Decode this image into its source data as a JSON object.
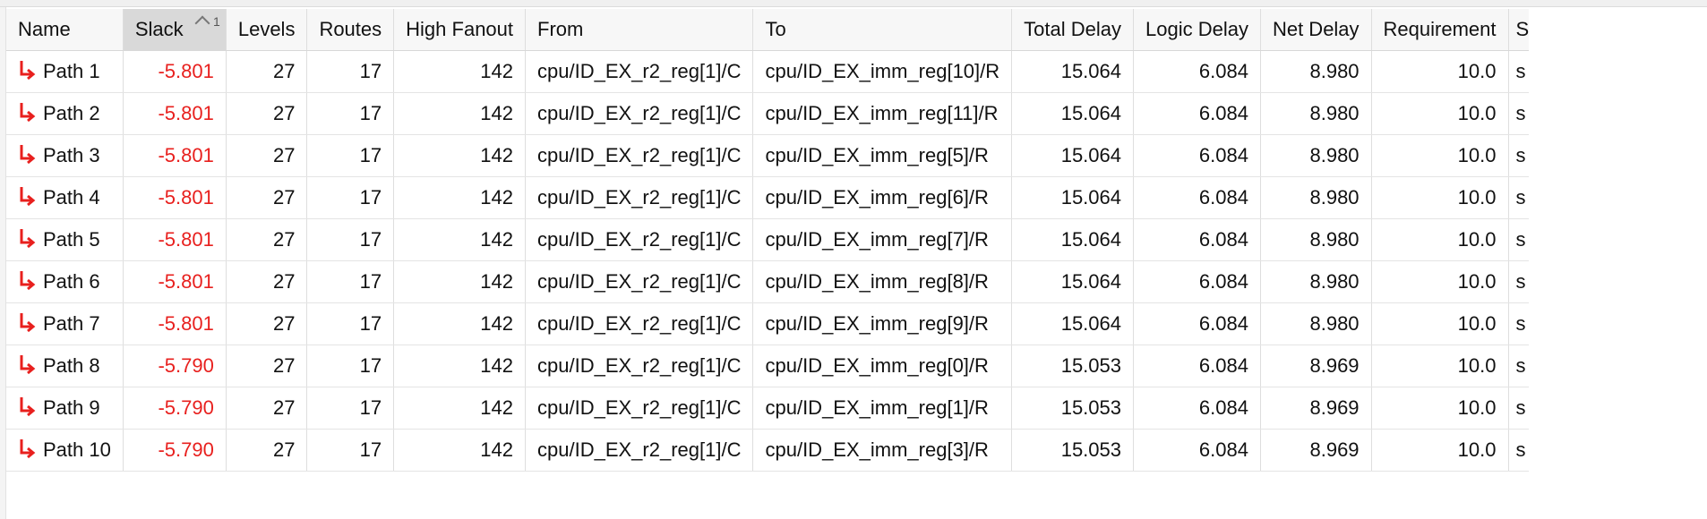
{
  "columns": {
    "name": "Name",
    "slack": "Slack",
    "slack_sort_rank": "1",
    "levels": "Levels",
    "routes": "Routes",
    "high_fanout": "High Fanout",
    "from": "From",
    "to": "To",
    "total_delay": "Total Delay",
    "logic_delay": "Logic Delay",
    "net_delay": "Net Delay",
    "requirement": "Requirement",
    "next_partial": "S"
  },
  "rows": [
    {
      "name": "Path 1",
      "slack": "-5.801",
      "levels": "27",
      "routes": "17",
      "high_fanout": "142",
      "from": "cpu/ID_EX_r2_reg[1]/C",
      "to": "cpu/ID_EX_imm_reg[10]/R",
      "total_delay": "15.064",
      "logic_delay": "6.084",
      "net_delay": "8.980",
      "requirement": "10.0",
      "next_partial": "s"
    },
    {
      "name": "Path 2",
      "slack": "-5.801",
      "levels": "27",
      "routes": "17",
      "high_fanout": "142",
      "from": "cpu/ID_EX_r2_reg[1]/C",
      "to": "cpu/ID_EX_imm_reg[11]/R",
      "total_delay": "15.064",
      "logic_delay": "6.084",
      "net_delay": "8.980",
      "requirement": "10.0",
      "next_partial": "s"
    },
    {
      "name": "Path 3",
      "slack": "-5.801",
      "levels": "27",
      "routes": "17",
      "high_fanout": "142",
      "from": "cpu/ID_EX_r2_reg[1]/C",
      "to": "cpu/ID_EX_imm_reg[5]/R",
      "total_delay": "15.064",
      "logic_delay": "6.084",
      "net_delay": "8.980",
      "requirement": "10.0",
      "next_partial": "s"
    },
    {
      "name": "Path 4",
      "slack": "-5.801",
      "levels": "27",
      "routes": "17",
      "high_fanout": "142",
      "from": "cpu/ID_EX_r2_reg[1]/C",
      "to": "cpu/ID_EX_imm_reg[6]/R",
      "total_delay": "15.064",
      "logic_delay": "6.084",
      "net_delay": "8.980",
      "requirement": "10.0",
      "next_partial": "s"
    },
    {
      "name": "Path 5",
      "slack": "-5.801",
      "levels": "27",
      "routes": "17",
      "high_fanout": "142",
      "from": "cpu/ID_EX_r2_reg[1]/C",
      "to": "cpu/ID_EX_imm_reg[7]/R",
      "total_delay": "15.064",
      "logic_delay": "6.084",
      "net_delay": "8.980",
      "requirement": "10.0",
      "next_partial": "s"
    },
    {
      "name": "Path 6",
      "slack": "-5.801",
      "levels": "27",
      "routes": "17",
      "high_fanout": "142",
      "from": "cpu/ID_EX_r2_reg[1]/C",
      "to": "cpu/ID_EX_imm_reg[8]/R",
      "total_delay": "15.064",
      "logic_delay": "6.084",
      "net_delay": "8.980",
      "requirement": "10.0",
      "next_partial": "s"
    },
    {
      "name": "Path 7",
      "slack": "-5.801",
      "levels": "27",
      "routes": "17",
      "high_fanout": "142",
      "from": "cpu/ID_EX_r2_reg[1]/C",
      "to": "cpu/ID_EX_imm_reg[9]/R",
      "total_delay": "15.064",
      "logic_delay": "6.084",
      "net_delay": "8.980",
      "requirement": "10.0",
      "next_partial": "s"
    },
    {
      "name": "Path 8",
      "slack": "-5.790",
      "levels": "27",
      "routes": "17",
      "high_fanout": "142",
      "from": "cpu/ID_EX_r2_reg[1]/C",
      "to": "cpu/ID_EX_imm_reg[0]/R",
      "total_delay": "15.053",
      "logic_delay": "6.084",
      "net_delay": "8.969",
      "requirement": "10.0",
      "next_partial": "s"
    },
    {
      "name": "Path 9",
      "slack": "-5.790",
      "levels": "27",
      "routes": "17",
      "high_fanout": "142",
      "from": "cpu/ID_EX_r2_reg[1]/C",
      "to": "cpu/ID_EX_imm_reg[1]/R",
      "total_delay": "15.053",
      "logic_delay": "6.084",
      "net_delay": "8.969",
      "requirement": "10.0",
      "next_partial": "s"
    },
    {
      "name": "Path 10",
      "slack": "-5.790",
      "levels": "27",
      "routes": "17",
      "high_fanout": "142",
      "from": "cpu/ID_EX_r2_reg[1]/C",
      "to": "cpu/ID_EX_imm_reg[3]/R",
      "total_delay": "15.053",
      "logic_delay": "6.084",
      "net_delay": "8.969",
      "requirement": "10.0",
      "next_partial": "s"
    }
  ],
  "colors": {
    "slack_negative": "#e8201e",
    "path_icon": "#e8201e",
    "sorted_header_bg": "#d9d9d9"
  },
  "icons": {
    "path": "failing-path-arrow-icon",
    "sort": "sort-ascending-caret-icon"
  }
}
